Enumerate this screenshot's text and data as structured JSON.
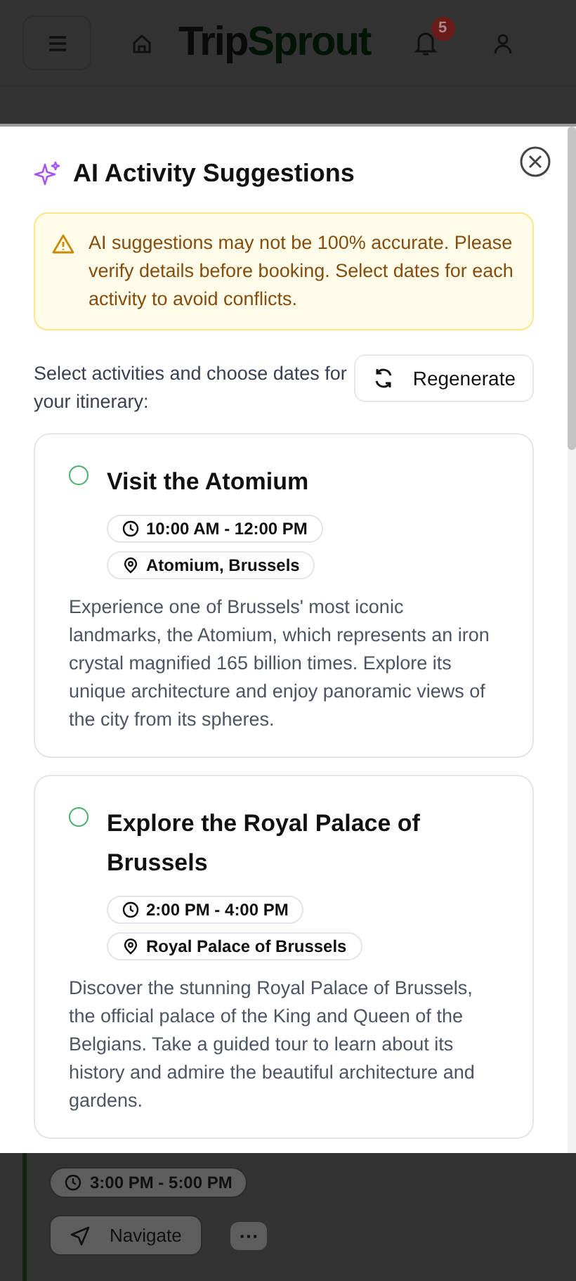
{
  "header": {
    "logo_parts": [
      "Trip",
      "Sprout"
    ],
    "notification_count": "5"
  },
  "modal": {
    "title": "AI Activity Suggestions",
    "warning": "AI suggestions may not be 100% accurate. Please verify details before booking. Select dates for each activity to avoid conflicts.",
    "instructions": "Select activities and choose dates for your itinerary:",
    "regenerate_label": "Regenerate",
    "activities": [
      {
        "title": "Visit the Atomium",
        "selected": false,
        "time": "10:00 AM - 12:00 PM",
        "location": "Atomium, Brussels",
        "description": "Experience one of Brussels' most iconic landmarks, the Atomium, which represents an iron crystal magnified 165 billion times. Explore its unique architecture and enjoy panoramic views of the city from its spheres."
      },
      {
        "title": "Explore the Royal Palace of Brussels",
        "selected": false,
        "time": "2:00 PM - 4:00 PM",
        "location": "Royal Palace of Brussels",
        "description": "Discover the stunning Royal Palace of Brussels, the official palace of the King and Queen of the Belgians. Take a guided tour to learn about its history and admire the beautiful architecture and gardens."
      }
    ]
  },
  "background_card": {
    "time": "3:00 PM - 5:00 PM",
    "navigate_label": "Navigate",
    "more_label": "···"
  }
}
